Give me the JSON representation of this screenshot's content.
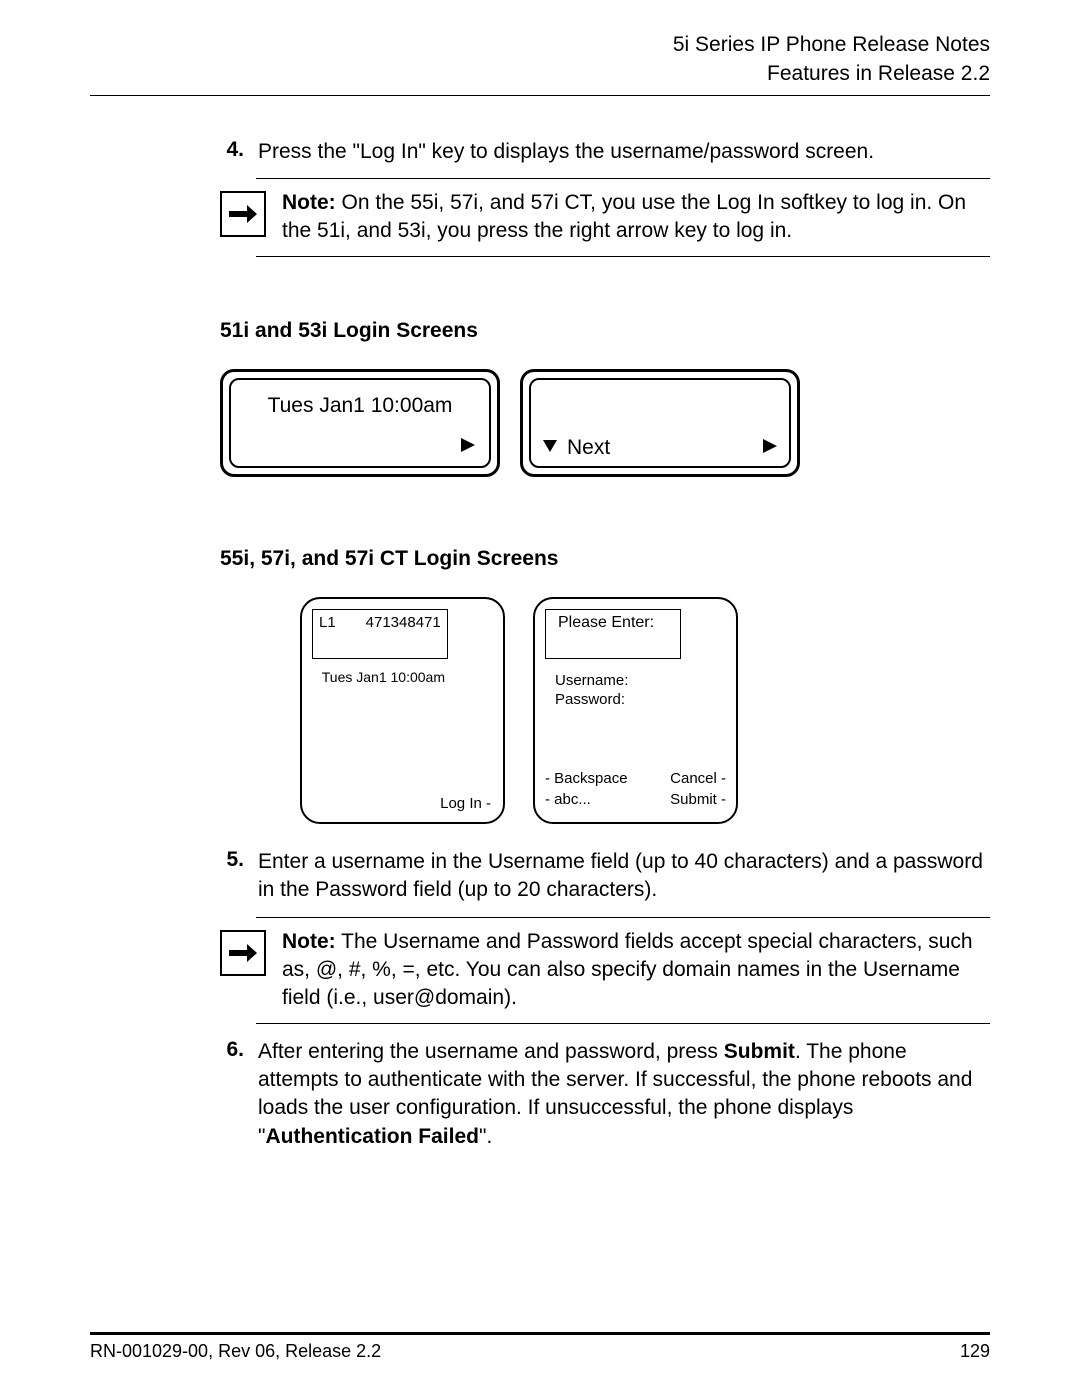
{
  "header": {
    "line1": "5i Series IP Phone Release Notes",
    "line2": "Features in Release 2.2"
  },
  "step4": {
    "num": "4.",
    "text": "Press the \"Log In\" key to displays the username/password screen."
  },
  "note1": {
    "label": "Note:",
    "text": " On the 55i, 57i, and 57i CT, you use the Log In softkey to log in. On the 51i, and 53i, you press the right arrow key to log in."
  },
  "subheading1": "51i and 53i Login Screens",
  "screen51": {
    "time": "Tues Jan1 10:00am",
    "next": "Next"
  },
  "subheading2": "55i, 57i, and 57i CT Login Screens",
  "screen55a": {
    "line": "L1",
    "number": "471348471",
    "time": "Tues Jan1 10:00am",
    "login": "Log In -"
  },
  "screen55b": {
    "please": "Please Enter:",
    "username": "Username:",
    "password": "Password:",
    "backspace": "- Backspace",
    "cancel": "Cancel -",
    "abc": "- abc...",
    "submit": "Submit -"
  },
  "step5": {
    "num": "5.",
    "text": "Enter a username in the Username field (up to 40 characters) and a password in the Password field (up to 20 characters)."
  },
  "note2": {
    "label": "Note:",
    "text": " The  Username  and  Password  fields accept special characters, such as, @, #, %, =, etc. You can also specify domain names in the Username field (i.e., user@domain)."
  },
  "step6": {
    "num": "6.",
    "text1": "After entering the username and password, press ",
    "submit": "Submit",
    "text2": ".\nThe phone attempts to authenticate with the server. If successful, the phone reboots and loads the user configuration. If unsuccessful, the phone displays \"",
    "authfail": "Authentication Failed",
    "text3": "\"."
  },
  "footer": {
    "left": "RN-001029-00, Rev 06, Release 2.2",
    "right": "129"
  }
}
